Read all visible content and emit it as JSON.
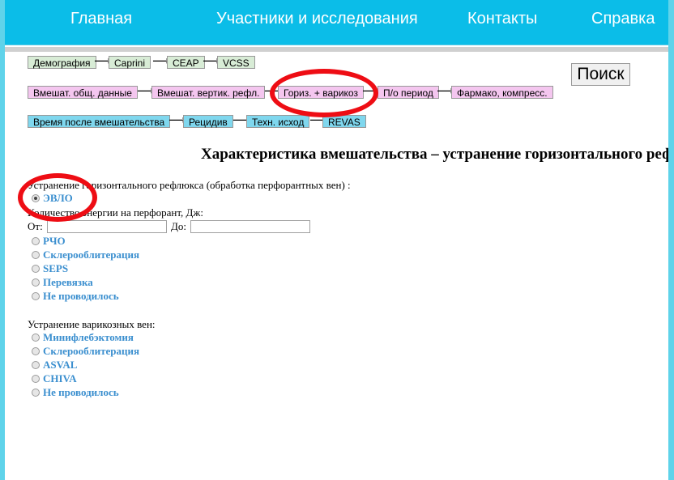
{
  "nav": {
    "home": "Главная",
    "participants": "Участники и исследования",
    "contacts": "Контакты",
    "help": "Справка"
  },
  "steps_row1": [
    "Демография",
    "Caprini",
    "CEAP",
    "VCSS"
  ],
  "steps_row2": [
    "Вмешат. общ. данные",
    "Вмешат. вертик. рефл.",
    "Гориз. + варикоз",
    "П/о период",
    "Фармако, компресс."
  ],
  "steps_row3": [
    "Время после вмешательства",
    "Рецидив",
    "Техн. исход",
    "REVAS"
  ],
  "arrow": "⟶",
  "search_label": "Поиск",
  "page_title": "Характеристика вмешательства – устранение горизонтального рефлюкса",
  "horizontal": {
    "label": "Устранение горизонтального рефлюкса (обработка перфорантных вен) :",
    "options": [
      "ЭВЛО",
      "РЧО",
      "Склерооблитерация",
      "SEPS",
      "Перевязка",
      "Не проводилось"
    ],
    "selected": "ЭВЛО",
    "energy_label": "Количество энергии на перфорант, Дж:",
    "from_label": "От:",
    "to_label": "До:",
    "from_value": "",
    "to_value": ""
  },
  "varicose": {
    "label": "Устранение варикозных вен:",
    "options": [
      "Минифлебэктомия",
      "Склерооблитерация",
      "ASVAL",
      "CHIVA",
      "Не проводилось"
    ]
  },
  "colors": {
    "header": "#0bbde8",
    "step_green": "#d8ecd6",
    "step_pink": "#f4c6ef",
    "step_blue": "#7fd7ee",
    "option_link": "#3b8fcf",
    "annotation_ring": "#ee0d14"
  }
}
